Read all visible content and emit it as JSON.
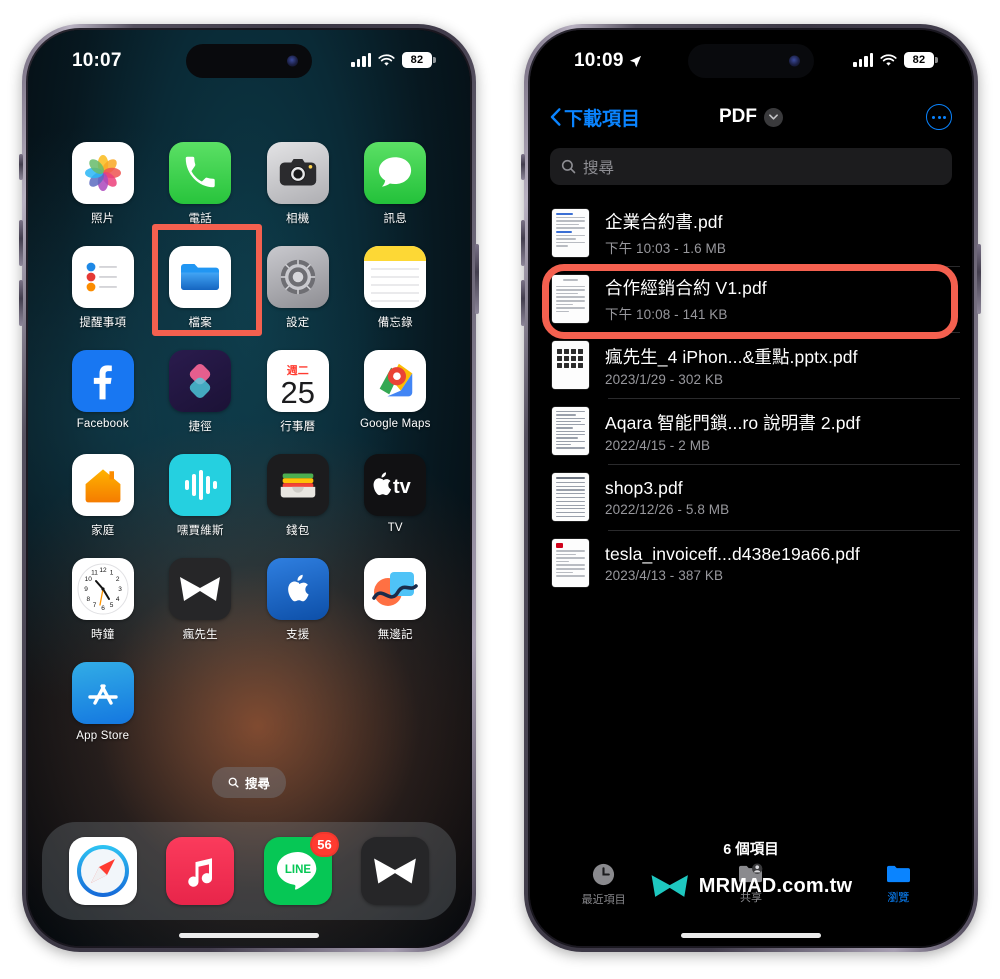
{
  "left_phone": {
    "status": {
      "time": "10:07",
      "battery": "82",
      "location_icon": false
    },
    "home_apps": [
      {
        "label": "照片",
        "icon": "photos-icon"
      },
      {
        "label": "電話",
        "icon": "phone-icon"
      },
      {
        "label": "相機",
        "icon": "camera-icon"
      },
      {
        "label": "訊息",
        "icon": "messages-icon"
      },
      {
        "label": "提醒事項",
        "icon": "reminders-icon"
      },
      {
        "label": "檔案",
        "icon": "files-icon"
      },
      {
        "label": "設定",
        "icon": "settings-icon"
      },
      {
        "label": "備忘錄",
        "icon": "notes-icon"
      },
      {
        "label": "Facebook",
        "icon": "facebook-icon"
      },
      {
        "label": "捷徑",
        "icon": "shortcuts-icon"
      },
      {
        "label": "行事曆",
        "icon": "calendar-icon",
        "calendar_weekday": "週二",
        "calendar_day": "25"
      },
      {
        "label": "Google Maps",
        "icon": "google-maps-icon"
      },
      {
        "label": "家庭",
        "icon": "home-icon"
      },
      {
        "label": "嘿賈維斯",
        "icon": "hey-jarvis-icon"
      },
      {
        "label": "錢包",
        "icon": "wallet-icon"
      },
      {
        "label": "TV",
        "icon": "apple-tv-icon"
      },
      {
        "label": "時鐘",
        "icon": "clock-icon"
      },
      {
        "label": "瘋先生",
        "icon": "mrmad-icon"
      },
      {
        "label": "支援",
        "icon": "apple-support-icon"
      },
      {
        "label": "無邊記",
        "icon": "freeform-icon"
      },
      {
        "label": "App Store",
        "icon": "app-store-icon"
      }
    ],
    "search_pill": "搜尋",
    "dock": [
      {
        "label": "Safari",
        "icon": "safari-icon",
        "badge": ""
      },
      {
        "label": "音樂",
        "icon": "music-icon",
        "badge": ""
      },
      {
        "label": "LINE",
        "icon": "line-icon",
        "badge": "56"
      },
      {
        "label": "瘋先生",
        "icon": "mrmad-icon",
        "badge": ""
      }
    ]
  },
  "right_phone": {
    "status": {
      "time": "10:09",
      "battery": "82",
      "location_icon": true
    },
    "nav": {
      "back_label": "下載項目",
      "title": "PDF",
      "more_label": "更多"
    },
    "search": {
      "placeholder": "搜尋"
    },
    "files": [
      {
        "name": "企業合約書.pdf",
        "meta": "下午 10:03 - 1.6 MB",
        "thumb": "document-thumb",
        "highlighted": false
      },
      {
        "name": "合作經銷合約 V1.pdf",
        "meta": "下午 10:08 - 141 KB",
        "thumb": "document-thumb",
        "highlighted": true
      },
      {
        "name": "瘋先生_4 iPhon...&重點.pptx.pdf",
        "meta": "2023/1/29 - 302 KB",
        "thumb": "grid-thumb",
        "highlighted": false
      },
      {
        "name": "Aqara 智能門鎖...ro 說明書 2.pdf",
        "meta": "2022/4/15 - 2 MB",
        "thumb": "schematic-thumb",
        "highlighted": false
      },
      {
        "name": "shop3.pdf",
        "meta": "2022/12/26 - 5.8 MB",
        "thumb": "table-thumb",
        "highlighted": false
      },
      {
        "name": "tesla_invoiceff...d438e19a66.pdf",
        "meta": "2023/4/13 - 387 KB",
        "thumb": "invoice-thumb",
        "highlighted": false
      }
    ],
    "item_count": "6 個項目",
    "tabs": [
      {
        "label": "最近項目",
        "icon": "clock-tab-icon",
        "active": false
      },
      {
        "label": "共享",
        "icon": "shared-tab-icon",
        "active": false
      },
      {
        "label": "瀏覽",
        "icon": "browse-tab-icon",
        "active": true
      }
    ]
  },
  "watermark": {
    "brand": "MRMAD",
    "suffix": ".com.tw",
    "icon": "mrmad-logo-icon"
  },
  "colors": {
    "accent_blue": "#0A84FF",
    "callout_red": "#F4604F",
    "badge_red": "#FF3B30",
    "subtext_gray": "#98989D"
  }
}
